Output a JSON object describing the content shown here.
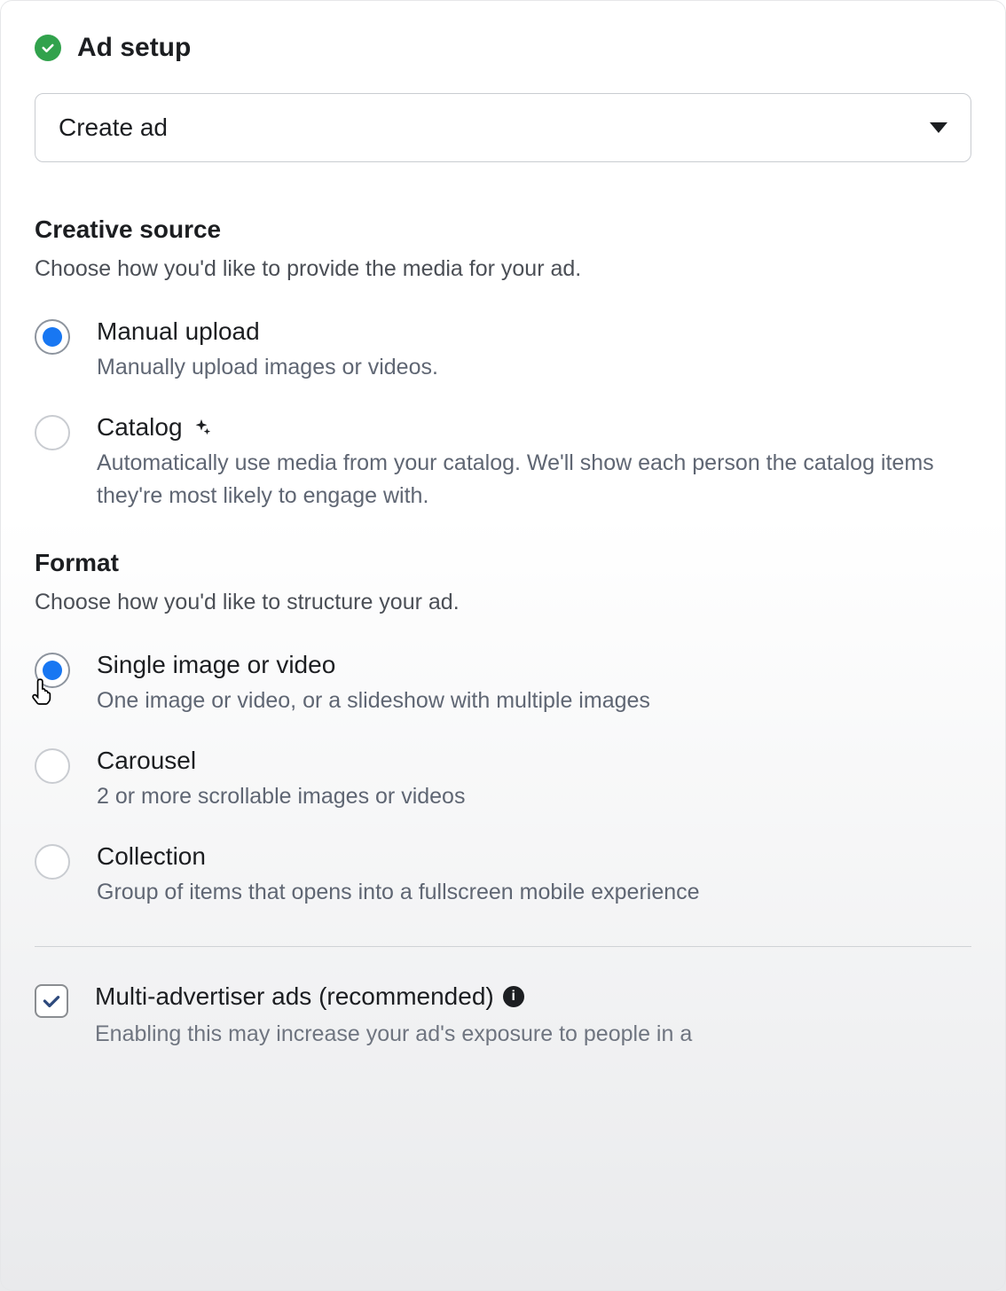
{
  "header": {
    "title": "Ad setup"
  },
  "dropdown": {
    "selected": "Create ad"
  },
  "creative_source": {
    "title": "Creative source",
    "subtitle": "Choose how you'd like to provide the media for your ad.",
    "options": [
      {
        "label": "Manual upload",
        "description": "Manually upload images or videos."
      },
      {
        "label": "Catalog",
        "description": "Automatically use media from your catalog. We'll show each person the catalog items they're most likely to engage with."
      }
    ]
  },
  "format": {
    "title": "Format",
    "subtitle": "Choose how you'd like to structure your ad.",
    "options": [
      {
        "label": "Single image or video",
        "description": "One image or video, or a slideshow with multiple images"
      },
      {
        "label": "Carousel",
        "description": "2 or more scrollable images or videos"
      },
      {
        "label": "Collection",
        "description": "Group of items that opens into a fullscreen mobile experience"
      }
    ]
  },
  "multi_advertiser": {
    "label": "Multi-advertiser ads (recommended)",
    "description": "Enabling this may increase your ad's exposure to people in a"
  }
}
